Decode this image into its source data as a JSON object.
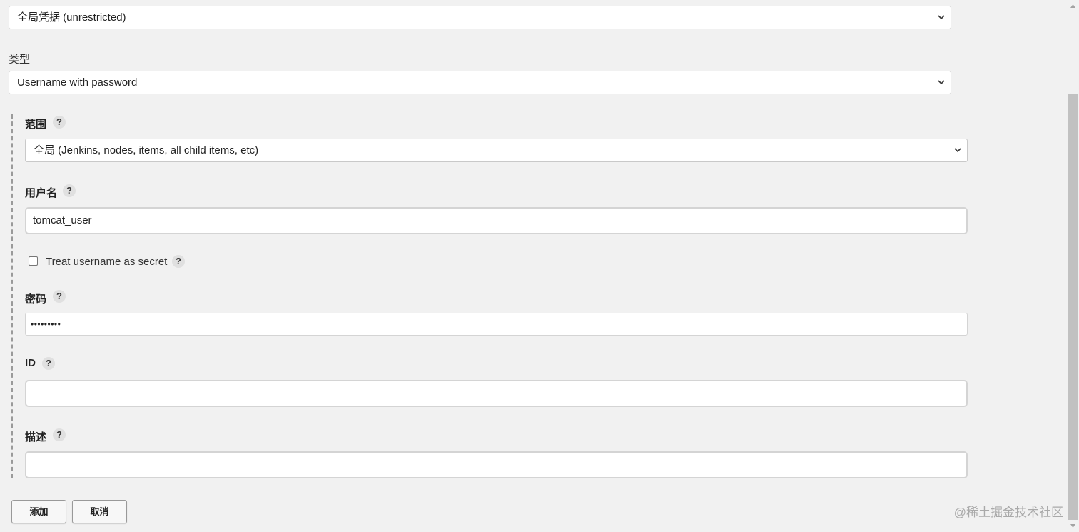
{
  "credential_store": {
    "value": "全局凭据 (unrestricted)"
  },
  "kind": {
    "label": "类型",
    "value": "Username with password"
  },
  "scope": {
    "label": "范围",
    "value": "全局 (Jenkins, nodes, items, all child items, etc)"
  },
  "username": {
    "label": "用户名",
    "value": "tomcat_user"
  },
  "secret_checkbox": {
    "label": "Treat username as secret",
    "checked": false
  },
  "password": {
    "label": "密码",
    "masked_value": "•••••••••"
  },
  "id_field": {
    "label": "ID",
    "value": ""
  },
  "description": {
    "label": "描述",
    "value": ""
  },
  "help_glyph": "?",
  "buttons": {
    "add": "添加",
    "cancel": "取消"
  },
  "watermark": "@稀土掘金技术社区",
  "colors": {
    "page_bg": "#f1f1f1",
    "input_border": "#d4d4d4",
    "scroll_thumb": "#c1c1c1"
  }
}
